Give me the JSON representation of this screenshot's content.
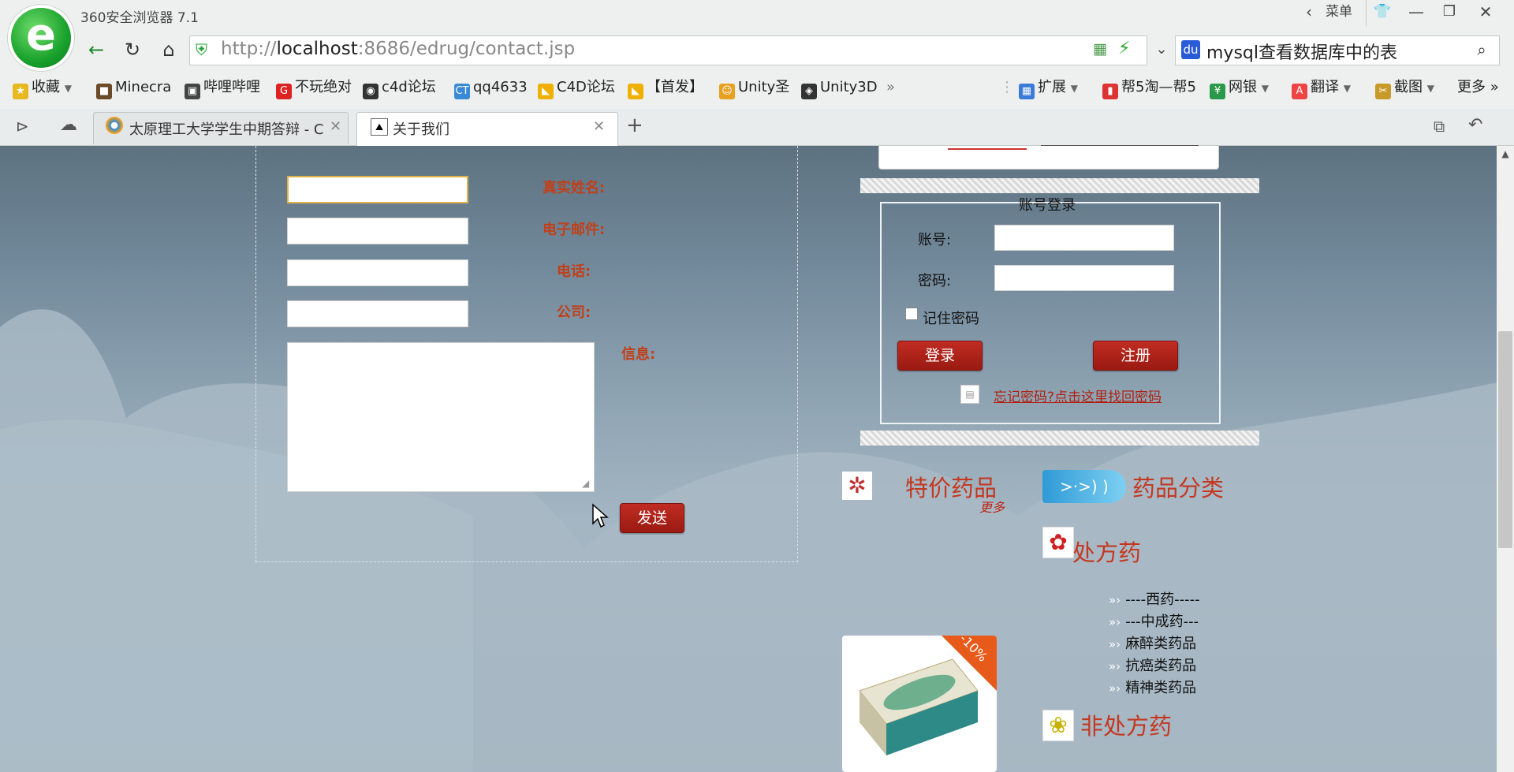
{
  "browser": {
    "title": "360安全浏览器 7.1",
    "menu_label": "菜单",
    "url_prefix": "http://",
    "url_host": "localhost",
    "url_rest": ":8686/edrug/contact.jsp",
    "search_text": "mysql查看数据库中的表",
    "bookmarks": [
      "收藏",
      "Minecra",
      "哔哩哔哩",
      "不玩绝对",
      "c4d论坛",
      "qq4633",
      "C4D论坛",
      "【首发】",
      "Unity圣",
      "Unity3D",
      "扩展",
      "帮5淘—帮5",
      "网银",
      "翻译",
      "截图",
      "更多"
    ],
    "tabs": [
      {
        "label": "太原理工大学学生中期答辩 - C"
      },
      {
        "label": "关于我们"
      }
    ]
  },
  "contact_form": {
    "name_label": "真实姓名:",
    "email_label": "电子邮件:",
    "phone_label": "电话:",
    "company_label": "公司:",
    "message_label": "信息:",
    "send_button": "发送"
  },
  "login": {
    "title": "账号登录",
    "account_label": "账号:",
    "password_label": "密码:",
    "remember_label": "记住密码",
    "login_button": "登录",
    "register_button": "注册",
    "forgot_link": "忘记密码?点击这里找回密码"
  },
  "sidebar": {
    "special_title": "特价药品",
    "more_link": "更多",
    "category_title": "药品分类",
    "rx_title": "处方药",
    "rx_items": [
      "----西药-----",
      "---中成药---",
      "麻醉类药品",
      "抗癌类药品",
      "精神类药品"
    ],
    "otc_title": "非处方药",
    "product_badge": "-10%"
  }
}
